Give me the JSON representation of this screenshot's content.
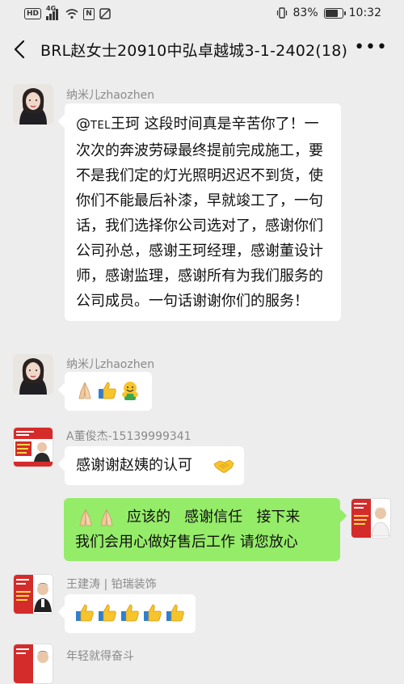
{
  "status_bar": {
    "hd": "HD",
    "network": "4G",
    "battery_pct": "83%",
    "battery_level": 0.83,
    "time": "10:32"
  },
  "header": {
    "title": "BRL赵女士20910中弘卓越城3-1-2402(18)",
    "back_icon": "chevron-left-icon",
    "more_icon": "more-dots-icon"
  },
  "messages": [
    {
      "sender": "纳米儿zhaozhen",
      "mention_prefix": "@",
      "mention_tel": "TEL",
      "text": "王珂  这段时间真是辛苦你了！一次次的奔波劳碌最终提前完成施工，要不是我们定的灯光照明迟迟不到货，使你们不能最后补漆，早就竣工了，一句话，我们选择你公司选对了，感谢你们公司孙总，感谢王珂经理，感谢董设计师，感谢监理，感谢所有为我们服务的公司成员。一句话谢谢你们的服务！"
    },
    {
      "sender": "纳米儿zhaozhen",
      "emojis": [
        "folded-hands-icon",
        "thumbs-up-icon",
        "hugging-face-icon"
      ]
    },
    {
      "sender": "A董俊杰-15139999341",
      "text": "感谢谢赵姨的认可",
      "emojis": [
        "handshake-icon"
      ]
    },
    {
      "sender": "me",
      "emojis": [
        "folded-hands-icon",
        "folded-hands-icon"
      ],
      "line1": "应该的   感谢信任   接下来",
      "line2": "我们会用心做好售后工作 请您放心"
    },
    {
      "sender": "王建涛 | 铂瑞装饰",
      "emojis": [
        "thumbs-up-icon",
        "thumbs-up-icon",
        "thumbs-up-icon",
        "thumbs-up-icon",
        "thumbs-up-icon"
      ]
    },
    {
      "sender": "年轻就得奋斗"
    }
  ],
  "colors": {
    "background": "#ededed",
    "bubble_in": "#ffffff",
    "bubble_out": "#95ec69",
    "name_gray": "#8a8a8a",
    "avatar_red": "#d42b2b"
  }
}
